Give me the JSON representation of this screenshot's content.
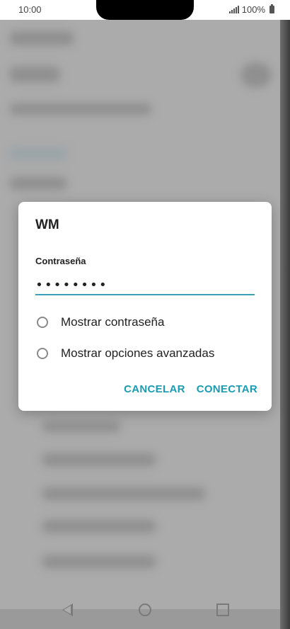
{
  "status_bar": {
    "time": "10:00",
    "battery": "100%"
  },
  "dialog": {
    "title": "WM",
    "password_label": "Contraseña",
    "password_value": "••••••••",
    "options": [
      {
        "label": "Mostrar contraseña",
        "checked": false
      },
      {
        "label": "Mostrar opciones avanzadas",
        "checked": false
      }
    ],
    "cancel_label": "CANCELAR",
    "connect_label": "CONECTAR"
  },
  "colors": {
    "accent": "#1b9bb0",
    "underline": "#3aa0b4"
  }
}
